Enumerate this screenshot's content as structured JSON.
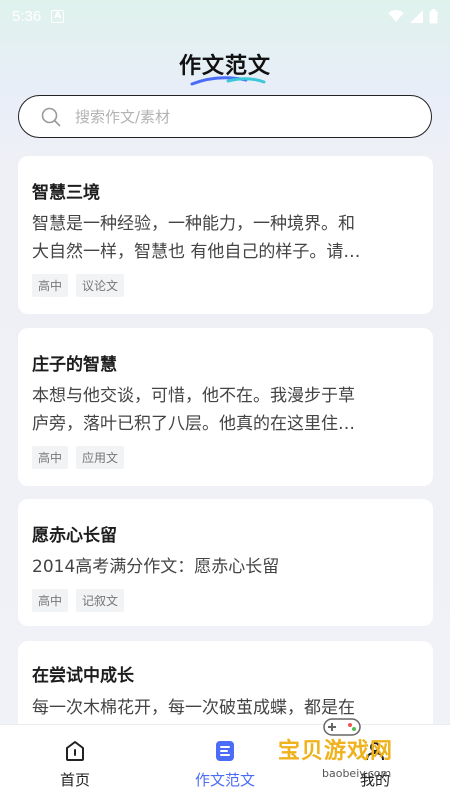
{
  "status_bar": {
    "time": "5:36",
    "notif_glyph": "A"
  },
  "header": {
    "title": "作文范文"
  },
  "search": {
    "placeholder": "搜索作文/素材"
  },
  "cards": [
    {
      "title": "智慧三境",
      "lines": [
        "智慧是一种经验，一种能力，一种境界。和",
        "大自然一样，智慧也 有他自己的样子。请…"
      ],
      "tags": [
        "高中",
        "议论文"
      ]
    },
    {
      "title": "庄子的智慧",
      "lines": [
        "本想与他交谈，可惜，他不在。我漫步于草",
        "庐旁，落叶已积了八层。他真的在这里住…"
      ],
      "tags": [
        "高中",
        "应用文"
      ]
    },
    {
      "title": "愿赤心长留",
      "lines": [
        "2014高考满分作文：愿赤心长留"
      ],
      "tags": [
        "高中",
        "记叙文"
      ]
    },
    {
      "title": "在尝试中成长",
      "lines": [
        "每一次木棉花开，每一次破茧成蝶，都是在"
      ],
      "tags": []
    }
  ],
  "tabbar": {
    "tabs": [
      {
        "label": "首页",
        "icon": "home-icon",
        "active": false
      },
      {
        "label": "作文范文",
        "icon": "document-icon",
        "active": true
      },
      {
        "label": "我的",
        "icon": "profile-icon",
        "active": false
      }
    ]
  },
  "watermark": {
    "text": "宝贝游戏网",
    "url": "baobeiy.com"
  },
  "colors": {
    "accent": "#4a6cf7",
    "watermark": "#f0b21c"
  }
}
